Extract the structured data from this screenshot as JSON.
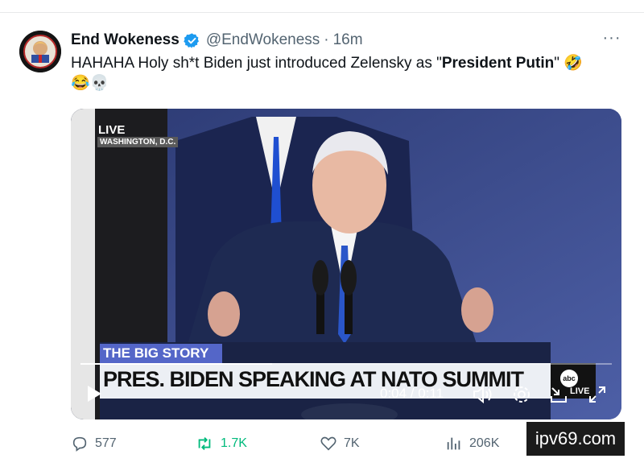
{
  "tweet": {
    "display_name": "End Wokeness",
    "handle": "@EndWokeness",
    "separator": "·",
    "time": "16m",
    "text_prefix": "HAHAHA Holy sh*t Biden just introduced Zelensky as \"",
    "text_bold": "President Putin",
    "text_suffix": "\"",
    "emojis_line1": "🤣",
    "emojis_line2": "😂💀",
    "more_label": "···"
  },
  "avatar": {
    "ring_text_top": "I SUPPORT THE",
    "ring_text_bottom": "TRUMP"
  },
  "video": {
    "live_badge": "LIVE",
    "location": "WASHINGTON, D.C.",
    "banner_top": "THE BIG STORY",
    "banner_main": "PRES. BIDEN SPEAKING AT NATO SUMMIT",
    "network_logo": "abc",
    "network_live": "LIVE",
    "time_display": "0:04 / 0:11",
    "progress": 0.36,
    "icons": [
      "play-icon",
      "volume-icon",
      "settings-icon",
      "pip-icon",
      "fullscreen-icon"
    ]
  },
  "actions": {
    "replies": "577",
    "reposts": "1.7K",
    "likes": "7K",
    "views": "206K"
  },
  "watermark": "ipv69.com",
  "colors": {
    "repost": "#00ba7c",
    "muted": "#536471",
    "verified": "#1d9bf0"
  }
}
